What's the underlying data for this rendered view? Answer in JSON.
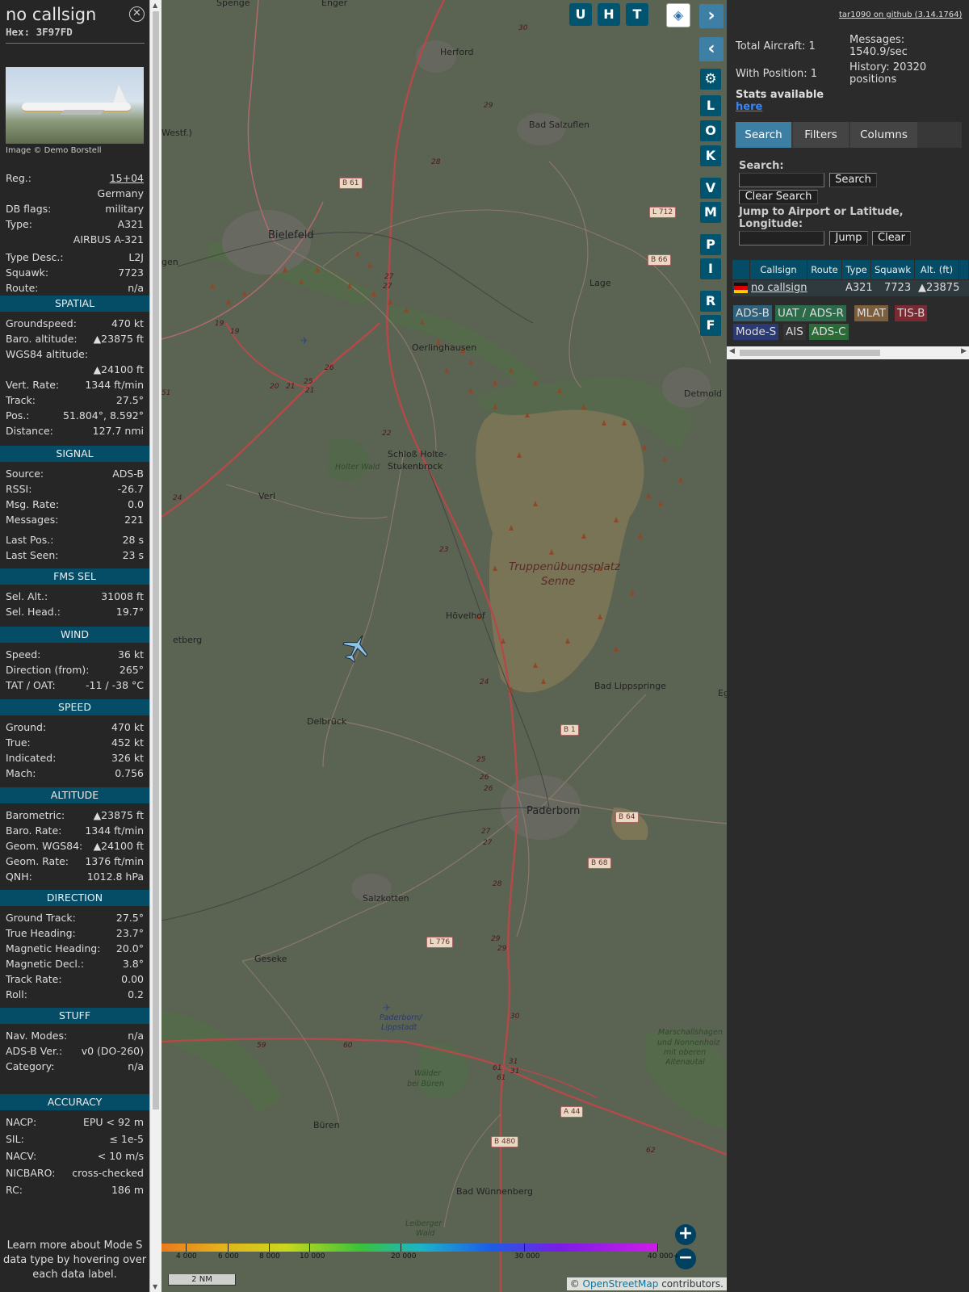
{
  "infoblock": {
    "callsign": "no callsign",
    "hex": "Hex: 3F97FD",
    "photo_credit": "Image © Demo Borstell",
    "rows_top": [
      {
        "k": "Reg.:",
        "v": "15+04",
        "link": true
      },
      {
        "k": "",
        "v": "Germany"
      },
      {
        "k": "DB flags:",
        "v": "military"
      },
      {
        "k": "Type:",
        "v": "A321"
      },
      {
        "k": "",
        "v": "AIRBUS A-321"
      },
      {
        "k": "Type Desc.:",
        "v": "L2J"
      },
      {
        "k": "Squawk:",
        "v": "7723"
      },
      {
        "k": "Route:",
        "v": "n/a"
      }
    ],
    "sections": [
      {
        "title": "SPATIAL",
        "rows": [
          {
            "k": "Groundspeed:",
            "v": "470 kt"
          },
          {
            "k": "Baro. altitude:",
            "v": "▲23875 ft"
          },
          {
            "k": "WGS84 altitude:",
            "v": ""
          },
          {
            "k": "",
            "v": "▲24100 ft"
          },
          {
            "k": "Vert. Rate:",
            "v": "1344 ft/min"
          },
          {
            "k": "Track:",
            "v": "27.5°"
          },
          {
            "k": "Pos.:",
            "v": "51.804°, 8.592°"
          },
          {
            "k": "Distance:",
            "v": "127.7 nmi"
          }
        ]
      },
      {
        "title": "SIGNAL",
        "rows": [
          {
            "k": "Source:",
            "v": "ADS-B"
          },
          {
            "k": "RSSI:",
            "v": "-26.7"
          },
          {
            "k": "Msg. Rate:",
            "v": "0.0"
          },
          {
            "k": "Messages:",
            "v": "221"
          },
          {
            "k": "Last Pos.:",
            "v": "28 s"
          },
          {
            "k": "Last Seen:",
            "v": "23 s"
          }
        ]
      },
      {
        "title": "FMS SEL",
        "rows": [
          {
            "k": "Sel. Alt.:",
            "v": "31008 ft"
          },
          {
            "k": "Sel. Head.:",
            "v": "19.7°"
          }
        ]
      },
      {
        "title": "WIND",
        "rows": [
          {
            "k": "Speed:",
            "v": "36 kt"
          },
          {
            "k": "Direction (from):",
            "v": "265°"
          },
          {
            "k": "TAT / OAT:",
            "v": "-11 / -38 °C"
          }
        ]
      },
      {
        "title": "SPEED",
        "rows": [
          {
            "k": "Ground:",
            "v": "470 kt"
          },
          {
            "k": "True:",
            "v": "452 kt"
          },
          {
            "k": "Indicated:",
            "v": "326 kt"
          },
          {
            "k": "Mach:",
            "v": "0.756"
          }
        ]
      },
      {
        "title": "ALTITUDE",
        "rows": [
          {
            "k": "Barometric:",
            "v": "▲23875 ft"
          },
          {
            "k": "Baro. Rate:",
            "v": "1344 ft/min"
          },
          {
            "k": "Geom. WGS84:",
            "v": "▲24100 ft"
          },
          {
            "k": "Geom. Rate:",
            "v": "1376 ft/min"
          },
          {
            "k": "QNH:",
            "v": "1012.8 hPa"
          }
        ]
      },
      {
        "title": "DIRECTION",
        "rows": [
          {
            "k": "Ground Track:",
            "v": "27.5°"
          },
          {
            "k": "True Heading:",
            "v": "23.7°"
          },
          {
            "k": "Magnetic Heading:",
            "v": "20.0°"
          },
          {
            "k": "Magnetic Decl.:",
            "v": "3.8°"
          },
          {
            "k": "Track Rate:",
            "v": "0.00"
          },
          {
            "k": "Roll:",
            "v": "0.2"
          }
        ]
      },
      {
        "title": "STUFF",
        "rows": [
          {
            "k": "Nav. Modes:",
            "v": "n/a"
          },
          {
            "k": "ADS-B Ver.:",
            "v": "v0 (DO-260)"
          },
          {
            "k": "Category:",
            "v": "n/a"
          }
        ]
      },
      {
        "title": "ACCURACY",
        "rows": [
          {
            "k": "NACP:",
            "v": "EPU < 92 m"
          },
          {
            "k": "SIL:",
            "v": "≤ 1e-5"
          },
          {
            "k": "NACV:",
            "v": "< 10 m/s"
          },
          {
            "k": "NICBARO:",
            "v": "cross-checked"
          },
          {
            "k": "RC:",
            "v": "186 m"
          }
        ]
      }
    ],
    "learn_more": "Learn more about Mode S data type by hovering over each data label."
  },
  "map": {
    "places": [
      {
        "t": "Spenge"
      },
      {
        "t": "Enger"
      },
      {
        "t": "Herford"
      },
      {
        "t": "Bad Salzuflen"
      },
      {
        "t": "Westf.)"
      },
      {
        "t": "Bielefeld",
        "big": true
      },
      {
        "t": "gen"
      },
      {
        "t": "Lage"
      },
      {
        "t": "Oerlinghausen"
      },
      {
        "t": "Detmold"
      },
      {
        "t": "Schloß Holte-"
      },
      {
        "t": "Stukenbrock"
      },
      {
        "t": "Holter Wald"
      },
      {
        "t": "Verl"
      },
      {
        "t": "Truppenübungsplatz"
      },
      {
        "t": "Senne"
      },
      {
        "t": "Hövelhof"
      },
      {
        "t": "etberg"
      },
      {
        "t": "Bad Lippspringe"
      },
      {
        "t": "Delbrück"
      },
      {
        "t": "Eg"
      },
      {
        "t": "Paderborn",
        "big": true
      },
      {
        "t": "Salzkotten"
      },
      {
        "t": "Geseke"
      },
      {
        "t": "Paderborn/"
      },
      {
        "t": "Lippstadt"
      },
      {
        "t": "Wälder"
      },
      {
        "t": "bei Büren"
      },
      {
        "t": "Marschallshagen"
      },
      {
        "t": "und Nonnenholz"
      },
      {
        "t": "mit oberen"
      },
      {
        "t": "Altenautal"
      },
      {
        "t": "Büren"
      },
      {
        "t": "Bad Wünnenberg"
      },
      {
        "t": "Leiberger"
      },
      {
        "t": "Wald"
      }
    ],
    "road_labels": [
      "B 61",
      "L 712",
      "B 66",
      "B 1",
      "B 64",
      "B 68",
      "L 776",
      "A 44",
      "B 480"
    ],
    "road_numbers": [
      "30",
      "29",
      "28",
      "27",
      "27",
      "19",
      "19",
      "26",
      "20",
      "21",
      "25",
      "21",
      "22",
      "51",
      "24",
      "23",
      "24",
      "25",
      "26",
      "26",
      "27",
      "27",
      "28",
      "29",
      "29",
      "30",
      "59",
      "60",
      "61",
      "31",
      "61",
      "31",
      "62"
    ],
    "top_buttons": [
      "U",
      "H",
      "T"
    ],
    "side_buttons": [
      "L",
      "O",
      "K",
      "V",
      "M",
      "P",
      "I",
      "R",
      "F"
    ],
    "colorbar_ticks": [
      "4 000",
      "6 000",
      "8 000",
      "10 000",
      "20 000",
      "30 000",
      "40 000+"
    ],
    "scale": "2 NM",
    "osm_prefix": "© ",
    "osm_link": "OpenStreetMap",
    "osm_suffix": " contributors."
  },
  "panel": {
    "github": "tar1090 on github (3.14.1764)",
    "total_aircraft": "Total Aircraft: 1",
    "messages": "Messages:",
    "messages_rate": "1540.9/sec",
    "with_position": "With Position: 1",
    "history": "History: 20320",
    "history2": "positions",
    "stats_available": "Stats available",
    "here": "here",
    "tabs": [
      "Search",
      "Filters",
      "Columns"
    ],
    "search_label": "Search:",
    "search_button": "Search",
    "clear_search": "Clear Search",
    "jump_label": "Jump to Airport or Latitude, Longitude:",
    "jump_button": "Jump",
    "clear_button": "Clear",
    "table_headers": [
      "Callsign",
      "Route",
      "Type",
      "Squawk",
      "Alt. (ft)"
    ],
    "table_row": {
      "callsign": "no callsign",
      "route": "",
      "type": "A321",
      "squawk": "7723",
      "alt": "▲23875"
    },
    "legend": [
      {
        "t": "ADS-B",
        "bg": "#2e6079"
      },
      {
        "t": "UAT / ADS-R",
        "bg": "#2c6b4a"
      },
      {
        "t": "MLAT",
        "bg": "#7d5e3c"
      },
      {
        "t": "TIS-B",
        "bg": "#7a2a32"
      },
      {
        "t": "Mode-S",
        "bg": "#2b3a73"
      },
      {
        "t": "AIS",
        "bg": "#333333"
      },
      {
        "t": "ADS-C",
        "bg": "#2c6b38"
      }
    ]
  }
}
